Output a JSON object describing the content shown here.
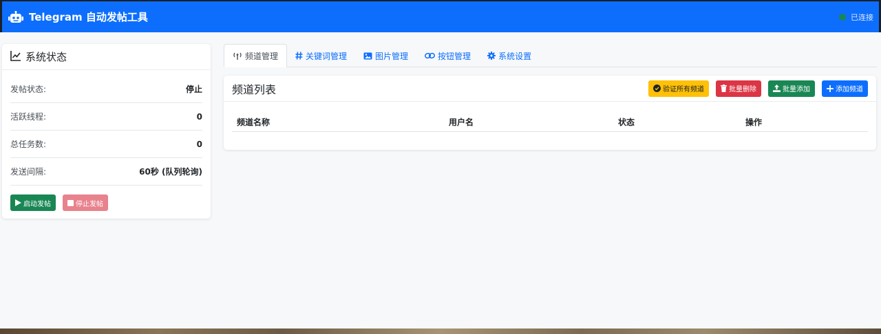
{
  "navbar": {
    "brand_icon": "robot-icon",
    "title": "Telegram 自动发帖工具",
    "connection": {
      "label": "已连接",
      "color": "#198754"
    }
  },
  "status": {
    "icon": "chart-line-icon",
    "title": "系统状态",
    "rows": [
      {
        "label": "发帖状态:",
        "value": "停止"
      },
      {
        "label": "活跃线程:",
        "value": "0"
      },
      {
        "label": "总任务数:",
        "value": "0"
      },
      {
        "label": "发送间隔:",
        "value": "60秒 (队列轮询)"
      }
    ],
    "start_label": "启动发帖",
    "stop_label": "停止发帖"
  },
  "tabs": [
    {
      "icon": "broadcast-icon",
      "label": "频道管理",
      "active": true
    },
    {
      "icon": "hashtag-icon",
      "label": "关键词管理",
      "active": false
    },
    {
      "icon": "image-icon",
      "label": "图片管理",
      "active": false
    },
    {
      "icon": "link-icon",
      "label": "按钮管理",
      "active": false
    },
    {
      "icon": "gear-icon",
      "label": "系统设置",
      "active": false
    }
  ],
  "channels": {
    "title": "频道列表",
    "buttons": {
      "verify_all": "验证所有频道",
      "bulk_delete": "批量删除",
      "bulk_add": "批量添加",
      "add_channel": "添加频道"
    },
    "columns": [
      "频道名称",
      "用户名",
      "状态",
      "操作"
    ]
  },
  "colors": {
    "primary": "#0d6efd",
    "success": "#198754",
    "danger": "#dc3545",
    "warning": "#ffc107"
  }
}
